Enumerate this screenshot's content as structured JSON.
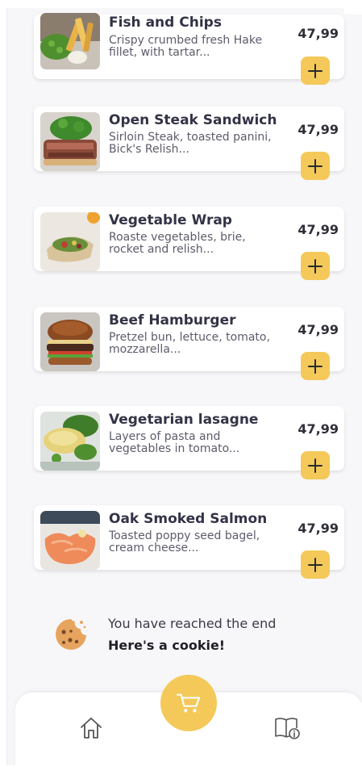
{
  "menu_items": [
    {
      "name": "Fish and Chips",
      "description": "Crispy crumbed fresh Hake fillet, with tartar...",
      "price": "47,99"
    },
    {
      "name": "Open Steak Sandwich",
      "description": "Sirloin Steak, toasted panini, Bick's Relish...",
      "price": "47,99"
    },
    {
      "name": "Vegetable Wrap",
      "description": "Roaste vegetables, brie, rocket and relish...",
      "price": "47,99"
    },
    {
      "name": "Beef Hamburger",
      "description": "Pretzel bun, lettuce, tomato, mozzarella...",
      "price": "47,99"
    },
    {
      "name": "Vegetarian lasagne",
      "description": "Layers of pasta and vegetables in tomato...",
      "price": "47,99"
    },
    {
      "name": "Oak Smoked Salmon",
      "description": "Toasted poppy seed bagel, cream cheese...",
      "price": "47,99"
    }
  ],
  "end_message": {
    "line1": "You have reached the end",
    "line2": "Here's a cookie!"
  },
  "icons": {
    "add": "plus-icon",
    "cookie": "cookie-icon",
    "home": "home-icon",
    "cart": "cart-icon",
    "menu_info": "book-info-icon"
  },
  "colors": {
    "accent": "#f4c95a",
    "background": "#f7f7f9",
    "card": "#ffffff",
    "title": "#333347",
    "text": "#5c5c6c"
  }
}
